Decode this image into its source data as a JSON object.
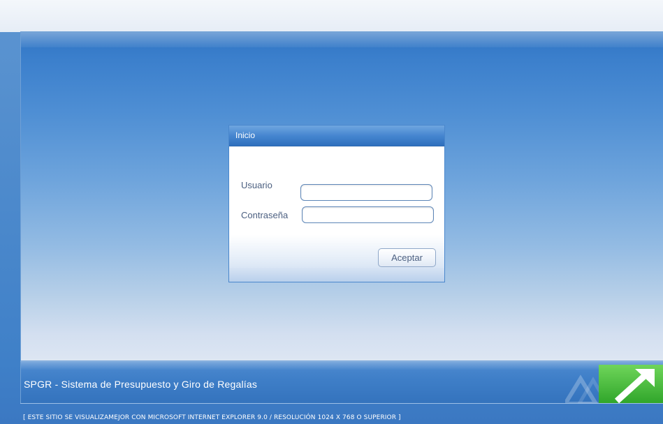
{
  "login": {
    "title": "Inicio",
    "user_label": "Usuario",
    "user_value": "",
    "password_label": "Contraseña",
    "password_value": "",
    "submit_label": "Aceptar"
  },
  "footer": {
    "app_name": "SPGR - Sistema de Presupuesto y Giro de Regalías",
    "notice": "[ ESTE SITIO SE VISUALIZAMEJOR CON MICROSOFT INTERNET EXPLORER 9.0 / RESOLUCIÓN 1024 X 768 O SUPERIOR ]",
    "logo_icon": "green-arrow-logo-icon"
  },
  "colors": {
    "brand_blue": "#3f80c8",
    "logo_green": "#3fbf3a"
  }
}
